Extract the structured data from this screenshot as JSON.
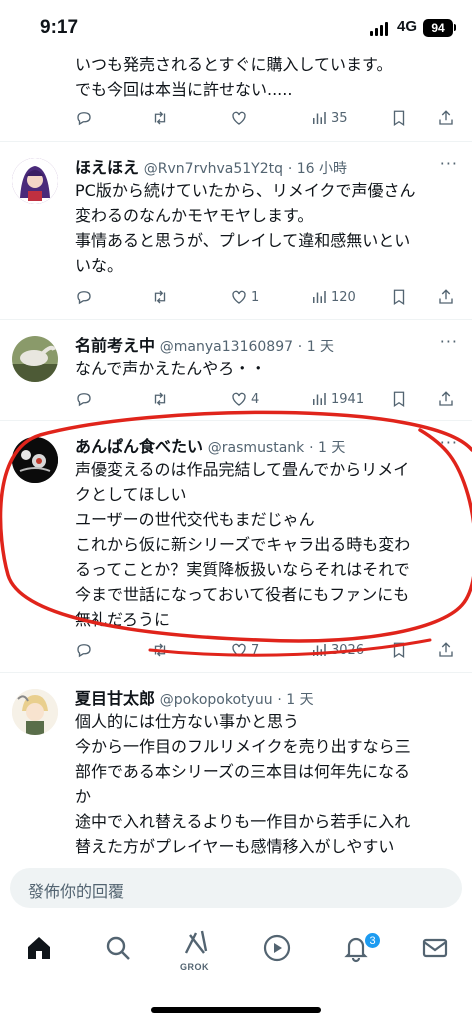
{
  "status_bar": {
    "time": "9:17",
    "network": "4G",
    "battery": "94"
  },
  "tweets": [
    {
      "text_lines": [
        "いつも発売されるとすぐに購入しています。",
        "でも今回は本当に許せない....."
      ],
      "stats": {
        "replies": "",
        "retweets": "",
        "likes": "",
        "views": "35"
      }
    },
    {
      "name": "ほえほえ",
      "handle": "@Rvn7rvhva51Y2tq",
      "time": "· 16 小時",
      "text_lines": [
        "PC版から続けていたから、リメイクで声優さん",
        "変わるのなんかモヤモヤします。",
        "事情あると思うが、プレイして違和感無いとい",
        "いな。"
      ],
      "stats": {
        "replies": "",
        "retweets": "",
        "likes": "1",
        "views": "120"
      }
    },
    {
      "name": "名前考え中",
      "handle": "@manya13160897",
      "time": "· 1 天",
      "text_lines": [
        "なんで声かえたんやろ・・"
      ],
      "stats": {
        "replies": "",
        "retweets": "",
        "likes": "4",
        "views": "1941"
      }
    },
    {
      "name": "あんぱん食べたい",
      "handle": "@rasmustank",
      "time": "· 1 天",
      "text_lines": [
        "声優変えるのは作品完結して畳んでからリメイ",
        "クとしてほしい",
        "ユーザーの世代交代もまだじゃん",
        "これから仮に新シリーズでキャラ出る時も変わ",
        "るってことか？実質降板扱いならそれはそれで",
        "今まで世話になっておいて役者にもファンにも",
        "無礼だろうに"
      ],
      "stats": {
        "replies": "",
        "retweets": "",
        "likes": "7",
        "views": "3026"
      }
    },
    {
      "name": "夏目甘太郎",
      "handle": "@pokopokotyuu",
      "time": "· 1 天",
      "text_lines": [
        "個人的には仕方ない事かと思う",
        "今から一作目のフルリメイクを売り出すなら三",
        "部作である本シリーズの三本目は何年先になる",
        "か",
        "途中で入れ替えるよりも一作目から若手に入れ",
        "替えた方がプレイヤーも感情移入がしやすい"
      ]
    }
  ],
  "compose": {
    "placeholder": "發佈你的回覆"
  },
  "tabbar": {
    "grok_label": "GROK",
    "notification_badge": "3"
  },
  "colors": {
    "accent": "#1d9bf0",
    "annotation": "#e0241b",
    "secondary_text": "#536471"
  }
}
